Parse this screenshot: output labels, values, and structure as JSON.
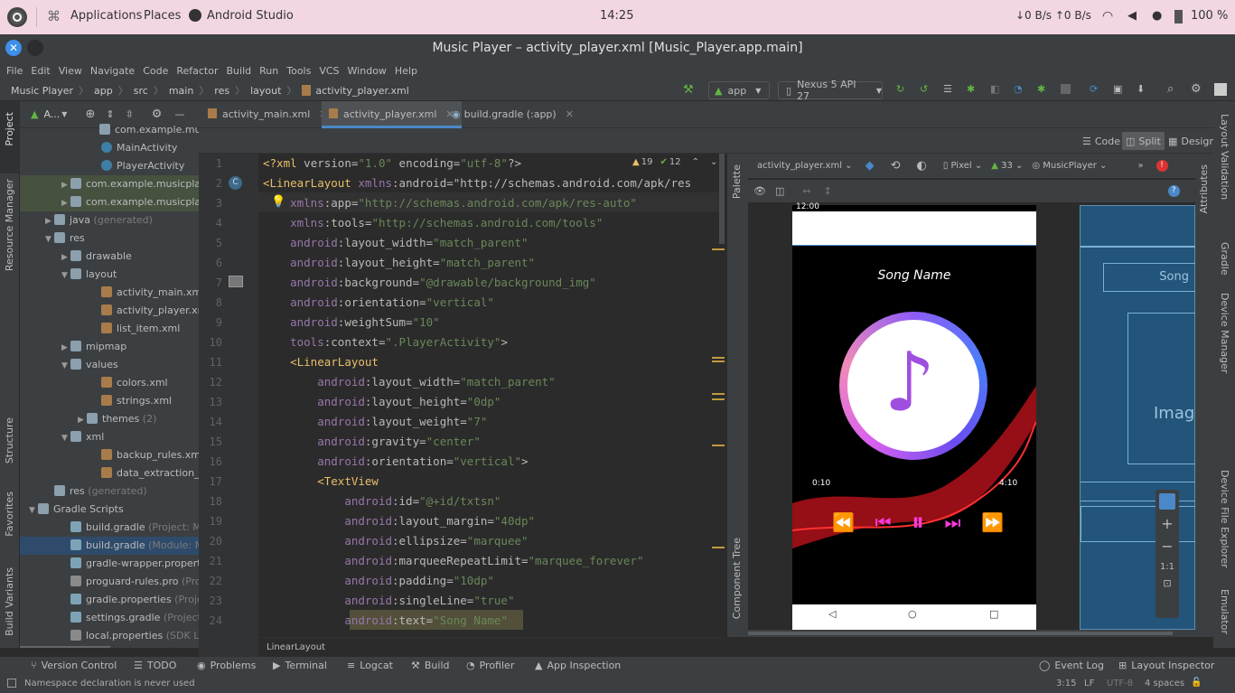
{
  "system": {
    "applications": "Applications",
    "places": "Places",
    "active_app": "Android Studio",
    "clock": "14:25",
    "net": "↓0 B/s ↑0 B/s",
    "battery": "100 %"
  },
  "window": {
    "title": "Music Player – activity_player.xml [Music_Player.app.main]"
  },
  "menu": [
    "File",
    "Edit",
    "View",
    "Navigate",
    "Code",
    "Refactor",
    "Build",
    "Run",
    "Tools",
    "VCS",
    "Window",
    "Help"
  ],
  "breadcrumb": [
    "Music Player",
    "app",
    "src",
    "main",
    "res",
    "layout",
    "activity_player.xml"
  ],
  "toolbar": {
    "run_config": "app",
    "device": "Nexus 5 API 27"
  },
  "project": {
    "header": "A...",
    "rows": [
      {
        "label": "com.example.musicplayer",
        "indent": 78,
        "tri": "",
        "gray": ""
      },
      {
        "label": "MainActivity",
        "indent": 80,
        "tri": "",
        "gray": ""
      },
      {
        "label": "PlayerActivity",
        "indent": 80,
        "tri": "",
        "gray": ""
      },
      {
        "label": "com.example.musicplayer",
        "indent": 46,
        "tri": "▶",
        "gray": ""
      },
      {
        "label": "com.example.musicplayer",
        "indent": 46,
        "tri": "▶",
        "gray": ""
      },
      {
        "label": "java",
        "indent": 28,
        "tri": "▶",
        "gray": " (generated)"
      },
      {
        "label": "res",
        "indent": 28,
        "tri": "▼",
        "gray": ""
      },
      {
        "label": "drawable",
        "indent": 46,
        "tri": "▶",
        "gray": ""
      },
      {
        "label": "layout",
        "indent": 46,
        "tri": "▼",
        "gray": ""
      },
      {
        "label": "activity_main.xml",
        "indent": 80,
        "tri": "",
        "gray": ""
      },
      {
        "label": "activity_player.xml",
        "indent": 80,
        "tri": "",
        "gray": ""
      },
      {
        "label": "list_item.xml",
        "indent": 80,
        "tri": "",
        "gray": ""
      },
      {
        "label": "mipmap",
        "indent": 46,
        "tri": "▶",
        "gray": ""
      },
      {
        "label": "values",
        "indent": 46,
        "tri": "▼",
        "gray": ""
      },
      {
        "label": "colors.xml",
        "indent": 80,
        "tri": "",
        "gray": ""
      },
      {
        "label": "strings.xml",
        "indent": 80,
        "tri": "",
        "gray": ""
      },
      {
        "label": "themes",
        "indent": 64,
        "tri": "▶",
        "gray": " (2)"
      },
      {
        "label": "xml",
        "indent": 46,
        "tri": "▼",
        "gray": ""
      },
      {
        "label": "backup_rules.xml",
        "indent": 80,
        "tri": "",
        "gray": ""
      },
      {
        "label": "data_extraction_rules",
        "indent": 80,
        "tri": "",
        "gray": ""
      },
      {
        "label": "res",
        "indent": 28,
        "tri": "",
        "gray": " (generated)"
      },
      {
        "label": "Gradle Scripts",
        "indent": 10,
        "tri": "▼",
        "gray": ""
      },
      {
        "label": "build.gradle",
        "indent": 46,
        "tri": "",
        "gray": " (Project: Music_Pla"
      },
      {
        "label": "build.gradle",
        "indent": 46,
        "tri": "",
        "gray": " (Module: Music_Pl"
      },
      {
        "label": "gradle-wrapper.properties",
        "indent": 46,
        "tri": "",
        "gray": " (G"
      },
      {
        "label": "proguard-rules.pro",
        "indent": 46,
        "tri": "",
        "gray": " (ProGuard"
      },
      {
        "label": "gradle.properties",
        "indent": 46,
        "tri": "",
        "gray": " (Project Prop"
      },
      {
        "label": "settings.gradle",
        "indent": 46,
        "tri": "",
        "gray": " (Project Settin"
      },
      {
        "label": "local.properties",
        "indent": 46,
        "tri": "",
        "gray": " (SDK Location"
      }
    ]
  },
  "left_strip": [
    "Project",
    "Resource Manager",
    "Structure",
    "Favorites",
    "Build Variants"
  ],
  "right_strip": [
    "Layout Validation",
    "Gradle",
    "Device Manager",
    "Device File Explorer",
    "Emulator"
  ],
  "tabs": [
    "activity_main.xml",
    "activity_player.xml",
    "build.gradle (:app)"
  ],
  "view_modes": [
    "Code",
    "Split",
    "Design"
  ],
  "inspections": {
    "warnings": "19",
    "ok": "12"
  },
  "code": [
    "<?xml version=\"1.0\" encoding=\"utf-8\"?>",
    "<LinearLayout xmlns:android=\"http://schemas.android.com/apk/res",
    "    xmlns:app=\"http://schemas.android.com/apk/res-auto\"",
    "    xmlns:tools=\"http://schemas.android.com/tools\"",
    "    android:layout_width=\"match_parent\"",
    "    android:layout_height=\"match_parent\"",
    "    android:background=\"@drawable/background_img\"",
    "    android:orientation=\"vertical\"",
    "    android:weightSum=\"10\"",
    "    tools:context=\".PlayerActivity\">",
    "    <LinearLayout",
    "        android:layout_width=\"match_parent\"",
    "        android:layout_height=\"0dp\"",
    "        android:layout_weight=\"7\"",
    "        android:gravity=\"center\"",
    "        android:orientation=\"vertical\">",
    "        <TextView",
    "            android:id=\"@+id/txtsn\"",
    "            android:layout_margin=\"40dp\"",
    "            android:ellipsize=\"marquee\"",
    "            android:marqueeRepeatLimit=\"marquee_forever\"",
    "            android:padding=\"10dp\"",
    "            android:singleLine=\"true\"",
    "            android:text=\"Song Name\""
  ],
  "breadcrumb_bottom": "LinearLayout",
  "design": {
    "file": "activity_player.xml",
    "pixel": "Pixel",
    "api": "33",
    "theme": "MusicPlayer",
    "palette": "Palette",
    "component_tree": "Component Tree",
    "attributes": "Attributes",
    "phone_time": "12:00",
    "song": "Song Name",
    "start_time": "0:10",
    "end_time": "4:10",
    "blueprint_song": "Song",
    "blueprint_image": "Imag",
    "zoom_fit": "1:1"
  },
  "bottom_tools": [
    "Version Control",
    "TODO",
    "Problems",
    "Terminal",
    "Logcat",
    "Build",
    "Profiler",
    "App Inspection"
  ],
  "bottom_right": [
    "Event Log",
    "Layout Inspector"
  ],
  "status": {
    "message": "Namespace declaration is never used",
    "pos": "3:15",
    "le": "LF",
    "enc": "UTF-8",
    "indent": "4 spaces"
  },
  "colors": {
    "accent": "#4a88c7",
    "pink": "#f73ad9",
    "tag": "#e8bf6a",
    "attr": "#9876aa",
    "str": "#6a8759"
  }
}
